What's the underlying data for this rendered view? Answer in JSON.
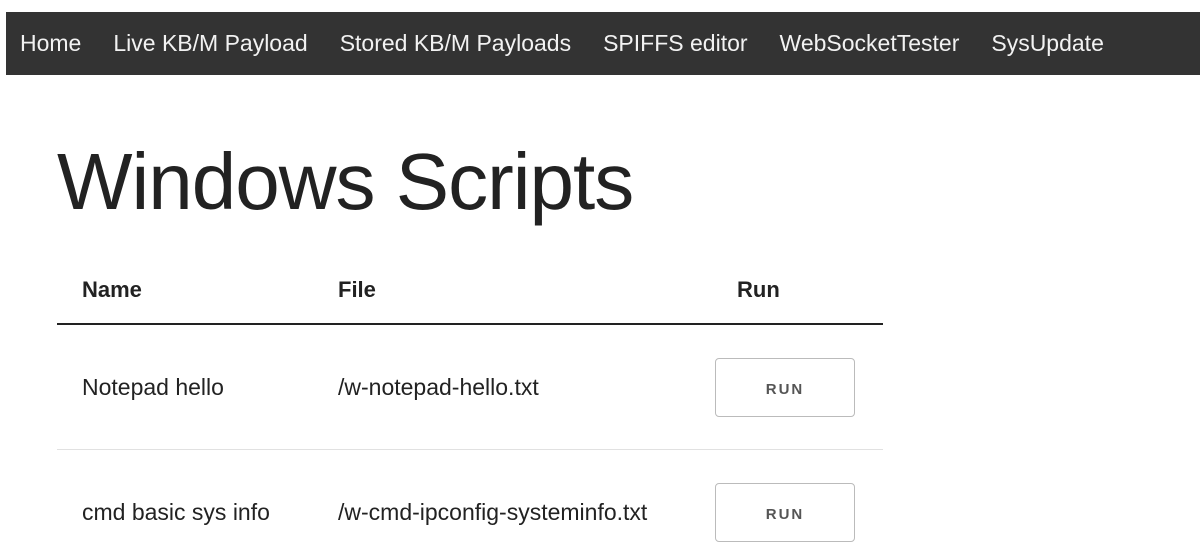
{
  "nav": {
    "items": [
      {
        "label": "Home"
      },
      {
        "label": "Live KB/M Payload"
      },
      {
        "label": "Stored KB/M Payloads"
      },
      {
        "label": "SPIFFS editor"
      },
      {
        "label": "WebSocketTester"
      },
      {
        "label": "SysUpdate"
      }
    ]
  },
  "page": {
    "title": "Windows Scripts"
  },
  "table": {
    "headers": {
      "name": "Name",
      "file": "File",
      "run": "Run"
    },
    "rows": [
      {
        "name": "Notepad hello",
        "file": "/w-notepad-hello.txt",
        "run_label": "RUN"
      },
      {
        "name": "cmd basic sys info",
        "file": "/w-cmd-ipconfig-systeminfo.txt",
        "run_label": "RUN"
      }
    ]
  },
  "colors": {
    "navbar_bg": "#333333",
    "nav_text": "#f2f2f2",
    "text": "#222222"
  }
}
